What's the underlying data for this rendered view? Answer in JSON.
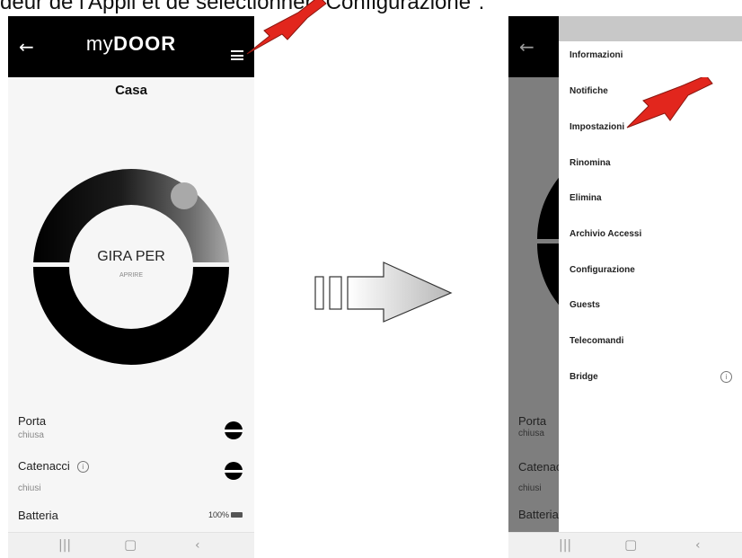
{
  "caption": "deur de l'Appli et de selectionner \"Configurazione\".",
  "app": {
    "logo_prefix": "my",
    "logo_brand": "DOOR",
    "title": "Casa",
    "dial_main": "GIRA PER",
    "dial_sub": "APRIRE"
  },
  "status": {
    "porta_label": "Porta",
    "porta_value": "chiusa",
    "catenacci_label": "Catenacci",
    "catenacci_value": "chiusi",
    "batteria_label": "Batteria",
    "batteria_value": "100%"
  },
  "menu": {
    "items": [
      "Informazioni",
      "Notifiche",
      "Impostazioni",
      "Rinomina",
      "Elimina",
      "Archivio Accessi",
      "Configurazione",
      "Guests",
      "Telecomandi",
      "Bridge"
    ]
  },
  "colors": {
    "annotation_arrow": "#e2261d",
    "topbar": "#000000"
  }
}
